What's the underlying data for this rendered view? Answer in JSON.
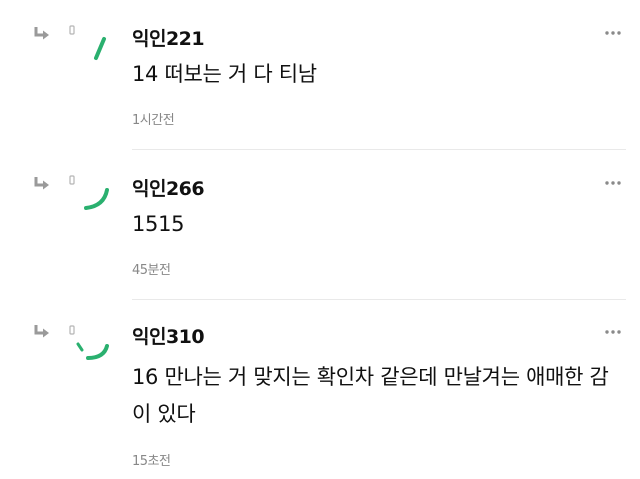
{
  "colors": {
    "accent": "#2ab06f",
    "time": "#888888",
    "icon": "#9a9a9a",
    "divider": "#e9e9e9"
  },
  "icons": {
    "reply": "reply-arrow-icon",
    "more": "more-dots-icon"
  },
  "comments": [
    {
      "nickname": "익인221",
      "text": "14 떠보는 거 다 티남",
      "time": "1시간전"
    },
    {
      "nickname": "익인266",
      "text": "1515",
      "time": "45분전"
    },
    {
      "nickname": "익인310",
      "text": "16 만나는 거 맞지는 확인차 같은데 만날겨는 애매한 감이 있다",
      "time": "15초전"
    }
  ]
}
